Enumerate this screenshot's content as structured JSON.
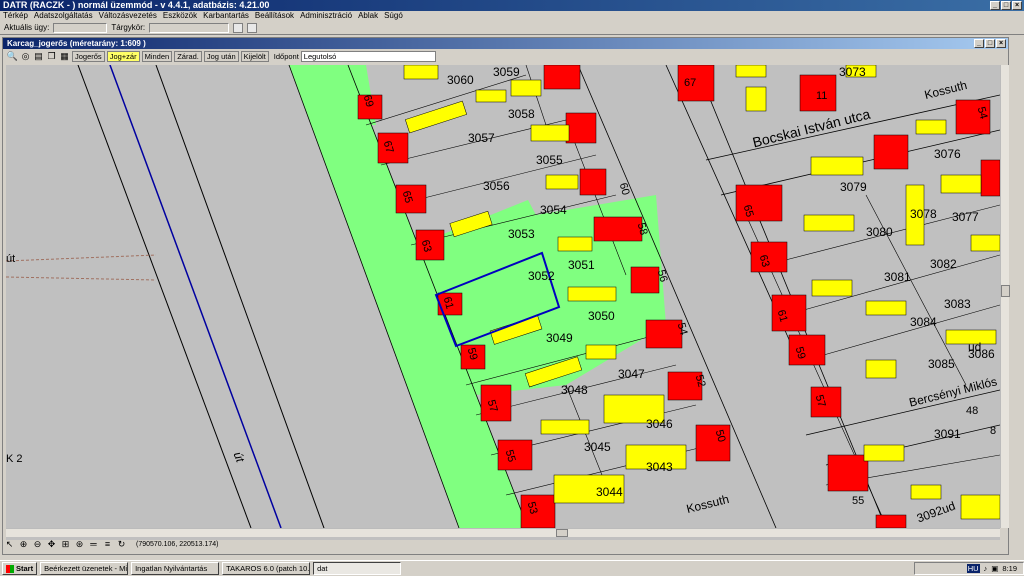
{
  "app": {
    "title": "DATR (RACZK - ) normál üzemmód - v 4.4.1, adatbázis: 4.21.00",
    "menu": [
      "Térkép",
      "Adatszolgáltatás",
      "Változásvezetés",
      "Eszközök",
      "Karbantartás",
      "Beállítások",
      "Adminisztráció",
      "Ablak",
      "Súgó"
    ],
    "context": {
      "aktualis_label": "Aktuális ügy:",
      "targykor_label": "Tárgykör:"
    }
  },
  "child": {
    "title": "Karcag_jogerős (méretarány: 1:609 )",
    "filters": [
      "Jogerős",
      "Jog+zár",
      "Minden",
      "Zárad.",
      "Jog után",
      "Kijelölt"
    ],
    "active_filter": "Jog+zár",
    "time_label": "Időpont",
    "time_value": "Legutolsó"
  },
  "status": {
    "coords": "(790570.106, 220513.174)"
  },
  "map": {
    "colors": {
      "background": "#c0c0c0",
      "green": "#80ff80",
      "red": "#ff0000",
      "yellow": "#ffff00",
      "line": "#000000",
      "blue": "#0000a0"
    },
    "streets": [
      "Bocskai István utca",
      "Bercsényi Miklós",
      "út",
      "út",
      "Kossuth",
      "Kossuth"
    ],
    "parcels": [
      "3060",
      "3059",
      "3058",
      "3057",
      "3056",
      "3055",
      "3054",
      "3053",
      "3052",
      "3051",
      "3050",
      "3049",
      "3048",
      "3047",
      "3046",
      "3045",
      "3044",
      "3043",
      "3073",
      "3076",
      "3079",
      "3080",
      "3078",
      "3077",
      "3082",
      "3081",
      "3083",
      "3084",
      "3085",
      "3086",
      "3091",
      "3092ud",
      "ud",
      "ud"
    ],
    "house_numbers": [
      "69",
      "67",
      "65",
      "63",
      "61",
      "59",
      "57",
      "55",
      "53",
      "60",
      "58",
      "56",
      "54",
      "52",
      "50",
      "67",
      "11",
      "54",
      "65",
      "63",
      "61",
      "59",
      "57",
      "55",
      "48",
      "8"
    ],
    "edge_labels": [
      "út",
      "K 2"
    ]
  },
  "taskbar": {
    "start": "Start",
    "items": [
      "Beérkezett üzenetek - Mi...",
      "Ingatlan Nyilvántartás",
      "TAKAROS 6.0 (patch 10....",
      "dat"
    ],
    "active": "dat",
    "tray_lang": "HU",
    "time": "8:19"
  }
}
